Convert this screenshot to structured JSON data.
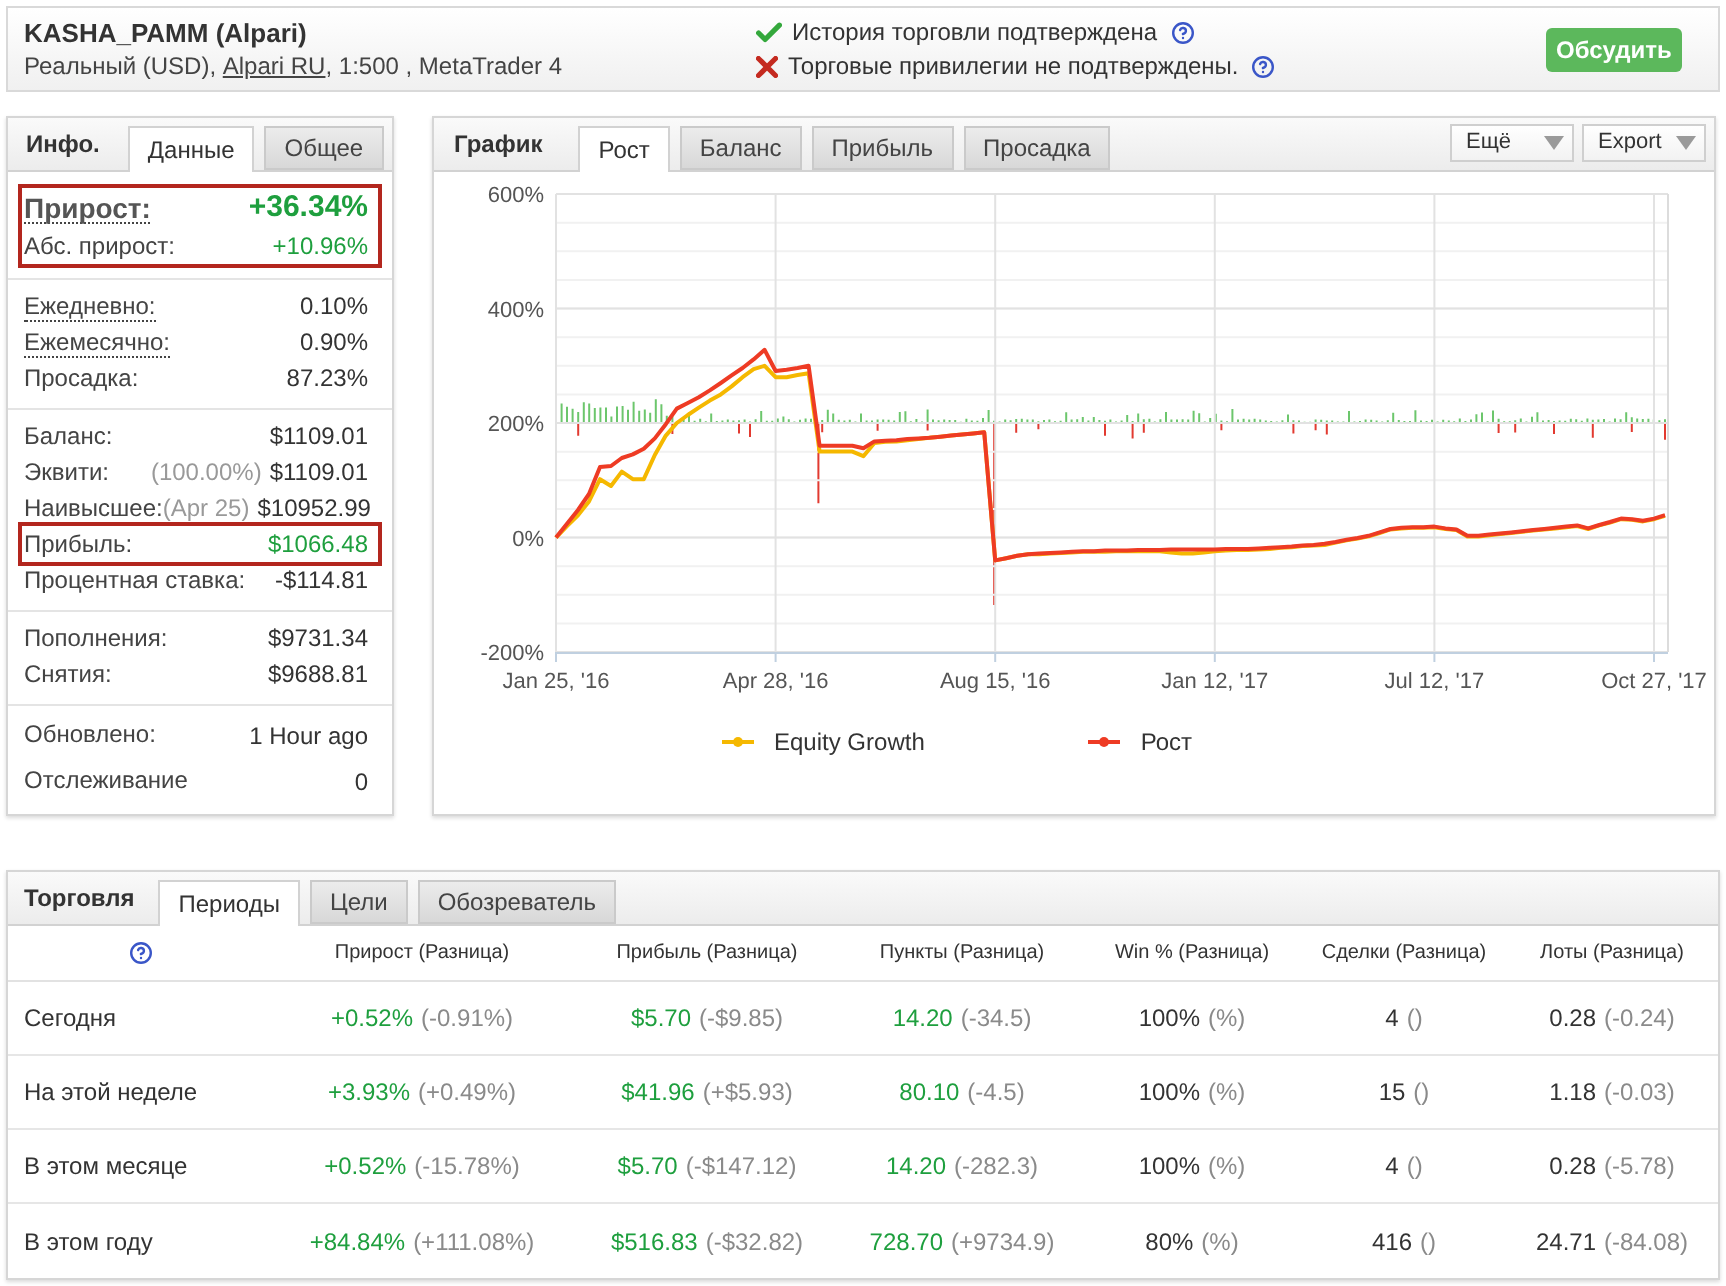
{
  "header": {
    "title": "KASHA_PAMM (Alpari)",
    "subtitle_before": "Реальный (USD),",
    "broker_link": "Alpari RU",
    "subtitle_after": ", 1:500 , MetaTrader 4",
    "verifications": [
      {
        "text": "История торговли подтверждена",
        "verified": true
      },
      {
        "text": "Торговые привилегии не подтверждены.",
        "verified": false
      }
    ],
    "discuss_button": "Обсудить"
  },
  "info_panel": {
    "title": "Инфо.",
    "tabs": [
      {
        "label": "Данные",
        "selected": true
      },
      {
        "label": "Общее",
        "selected": false
      }
    ],
    "sections": [
      {
        "rows": [
          {
            "kind": "headline",
            "label": "Прирост:",
            "value": "+36.34%",
            "color": "#1e9f3e",
            "underlined": true,
            "highlighted": true
          },
          {
            "kind": "stat",
            "label": "Абс. прирост:",
            "value": "+10.96%",
            "color": "#1e9f3e",
            "underlined": false,
            "highlighted": true
          }
        ]
      },
      {
        "rows": [
          {
            "kind": "stat",
            "label": "Ежедневно:",
            "value": "0.10%",
            "color": "#333333",
            "underlined": true,
            "highlighted": false
          },
          {
            "kind": "stat",
            "label": "Ежемесячно:",
            "value": "0.90%",
            "color": "#333333",
            "underlined": true,
            "highlighted": false
          },
          {
            "kind": "stat",
            "label": "Просадка:",
            "value": "87.23%",
            "color": "#333333",
            "underlined": false,
            "highlighted": false
          }
        ]
      },
      {
        "rows": [
          {
            "kind": "stat",
            "label": "Баланс:",
            "value": "$1109.01",
            "color": "#333333",
            "underlined": false,
            "highlighted": false
          },
          {
            "kind": "stat",
            "label": "Эквити:",
            "note": "(100.00%)",
            "value": "$1109.01",
            "color": "#333333",
            "underlined": false,
            "highlighted": false
          },
          {
            "kind": "stat",
            "label": "Наивысшее:",
            "note": "(Apr 25)",
            "value": "$10952.99",
            "color": "#333333",
            "underlined": false,
            "highlighted": false
          },
          {
            "kind": "stat",
            "label": "Прибыль:",
            "value": "$1066.48",
            "color": "#1e9f3e",
            "underlined": false,
            "highlighted": true
          },
          {
            "kind": "stat",
            "label": "Процентная ставка:",
            "value": "-$114.81",
            "color": "#333333",
            "underlined": false,
            "highlighted": false
          }
        ]
      },
      {
        "rows": [
          {
            "kind": "stat",
            "label": "Пополнения:",
            "value": "$9731.34",
            "color": "#333333",
            "underlined": false,
            "highlighted": false
          },
          {
            "kind": "stat",
            "label": "Снятия:",
            "value": "$9688.81",
            "color": "#333333",
            "underlined": false,
            "highlighted": false
          }
        ]
      },
      {
        "rows": [
          {
            "kind": "stat",
            "label": "Обновлено:",
            "value": "1 Hour ago",
            "color": "#333333",
            "underlined": false,
            "highlighted": false
          },
          {
            "kind": "stat",
            "label": "Отслеживание",
            "value": "0",
            "color": "#333333",
            "underlined": false,
            "highlighted": false
          }
        ]
      }
    ]
  },
  "chart_panel": {
    "title": "График",
    "tabs": [
      {
        "label": "Рост",
        "selected": true
      },
      {
        "label": "Баланс",
        "selected": false
      },
      {
        "label": "Прибыль",
        "selected": false
      },
      {
        "label": "Просадка",
        "selected": false
      }
    ],
    "menus": [
      "Ещё",
      "Export"
    ],
    "chart_data": {
      "type": "line",
      "grid": true,
      "categories": [
        "Jan 25, '16",
        null,
        null,
        null,
        null,
        null,
        null,
        null,
        null,
        null,
        null,
        null,
        null,
        null,
        null,
        null,
        null,
        null,
        null,
        null,
        "Apr 28, '16",
        null,
        null,
        null,
        null,
        null,
        null,
        null,
        null,
        null,
        null,
        null,
        null,
        null,
        null,
        null,
        null,
        null,
        null,
        null,
        "Aug 15, '16",
        null,
        null,
        null,
        null,
        null,
        null,
        null,
        null,
        null,
        null,
        null,
        null,
        null,
        null,
        null,
        null,
        null,
        null,
        null,
        "Jan 12, '17",
        null,
        null,
        null,
        null,
        null,
        null,
        null,
        null,
        null,
        null,
        null,
        null,
        null,
        null,
        null,
        null,
        null,
        null,
        null,
        "Jul 12, '17",
        null,
        null,
        null,
        null,
        null,
        null,
        null,
        null,
        null,
        null,
        null,
        null,
        null,
        null,
        null,
        null,
        null,
        null,
        null,
        "Oct 27, '17",
        null
      ],
      "series": [
        {
          "name": "Equity Growth",
          "color": "#f5b800",
          "values": [
            0,
            20,
            39,
            63,
            102,
            90,
            115,
            102,
            102,
            144,
            178,
            200,
            214,
            227,
            239,
            250,
            264,
            280,
            294,
            300,
            280,
            280,
            284,
            287,
            150,
            150,
            150,
            150,
            142,
            165,
            167,
            168,
            170,
            172,
            174,
            176,
            178,
            180,
            182,
            184,
            -40,
            -36,
            -32,
            -29,
            -29,
            -28,
            -27,
            -26,
            -25,
            -25,
            -25,
            -24,
            -24,
            -24,
            -24,
            -24,
            -26,
            -28,
            -28,
            -26,
            -24,
            -23,
            -22,
            -22,
            -21,
            -20,
            -18,
            -17,
            -15,
            -14,
            -13,
            -9,
            -5,
            -2,
            2,
            8,
            14,
            16,
            17,
            17,
            18,
            15,
            13,
            2,
            2,
            4,
            6,
            8,
            10,
            12,
            14,
            16,
            18,
            20,
            15,
            21,
            26,
            32,
            31,
            28,
            32,
            38
          ]
        },
        {
          "name": "Рост",
          "color": "#ee3b24",
          "values": [
            0,
            24,
            48,
            76,
            123,
            125,
            139,
            145,
            155,
            173,
            198,
            225,
            235,
            245,
            257,
            270,
            283,
            296,
            311,
            328,
            291,
            293,
            296,
            300,
            160,
            160,
            160,
            160,
            156,
            168,
            169,
            170,
            172,
            173,
            174,
            176,
            178,
            180,
            182,
            184,
            -40,
            -36,
            -32,
            -29,
            -28,
            -27,
            -26,
            -25,
            -24,
            -24,
            -23,
            -23,
            -23,
            -22,
            -22,
            -22,
            -21,
            -21,
            -21,
            -21,
            -21,
            -20,
            -20,
            -20,
            -19,
            -18,
            -17,
            -16,
            -14,
            -13,
            -11,
            -8,
            -4,
            -1,
            3,
            9,
            15,
            17,
            18,
            18,
            19,
            16,
            14,
            3,
            3,
            5,
            7,
            9,
            11,
            13,
            15,
            17,
            19,
            21,
            16,
            22,
            27,
            33,
            32,
            29,
            33,
            39
          ]
        }
      ],
      "ylim": [
        -200,
        600
      ],
      "yticks": [
        {
          "value": -200,
          "label": "-200%"
        },
        {
          "value": 0,
          "label": "0%"
        },
        {
          "value": 200,
          "label": "200%"
        },
        {
          "value": 400,
          "label": "400%"
        },
        {
          "value": 600,
          "label": "600%"
        }
      ]
    }
  },
  "trading_panel": {
    "title": "Торговля",
    "tabs": [
      {
        "label": "Периоды",
        "selected": true
      },
      {
        "label": "Цели",
        "selected": false
      },
      {
        "label": "Обозреватель",
        "selected": false
      }
    ],
    "columns": [
      {
        "label": "Прирост (Разница)",
        "color": "#1e9f3e"
      },
      {
        "label": "Прибыль (Разница)",
        "color": "#1e9f3e"
      },
      {
        "label": "Пункты (Разница)",
        "color": "#1e9f3e"
      },
      {
        "label": "Win % (Разница)",
        "color": "#333333"
      },
      {
        "label": "Сделки (Разница)",
        "color": "#333333"
      },
      {
        "label": "Лоты (Разница)",
        "color": "#333333"
      }
    ],
    "rows": [
      {
        "period": "Сегодня",
        "cells": [
          {
            "value": "+0.52%",
            "diff": "(-0.91%)"
          },
          {
            "value": "$5.70",
            "diff": "(-$9.85)"
          },
          {
            "value": "14.20",
            "diff": "(-34.5)"
          },
          {
            "value": "100%",
            "diff": "(%)"
          },
          {
            "value": "4",
            "diff": "()"
          },
          {
            "value": "0.28",
            "diff": "(-0.24)"
          }
        ]
      },
      {
        "period": "На этой неделе",
        "cells": [
          {
            "value": "+3.93%",
            "diff": "(+0.49%)"
          },
          {
            "value": "$41.96",
            "diff": "(+$5.93)"
          },
          {
            "value": "80.10",
            "diff": "(-4.5)"
          },
          {
            "value": "100%",
            "diff": "(%)"
          },
          {
            "value": "15",
            "diff": "()"
          },
          {
            "value": "1.18",
            "diff": "(-0.03)"
          }
        ]
      },
      {
        "period": "В этом месяце",
        "cells": [
          {
            "value": "+0.52%",
            "diff": "(-15.78%)"
          },
          {
            "value": "$5.70",
            "diff": "(-$147.12)"
          },
          {
            "value": "14.20",
            "diff": "(-282.3)"
          },
          {
            "value": "100%",
            "diff": "(%)"
          },
          {
            "value": "4",
            "diff": "()"
          },
          {
            "value": "0.28",
            "diff": "(-5.78)"
          }
        ]
      },
      {
        "period": "В этом году",
        "cells": [
          {
            "value": "+84.84%",
            "diff": "(+111.08%)"
          },
          {
            "value": "$516.83",
            "diff": "(-$32.82)"
          },
          {
            "value": "728.70",
            "diff": "(+9734.9)"
          },
          {
            "value": "80%",
            "diff": "(%)"
          },
          {
            "value": "416",
            "diff": "()"
          },
          {
            "value": "24.71",
            "diff": "(-84.08)"
          }
        ]
      }
    ]
  }
}
